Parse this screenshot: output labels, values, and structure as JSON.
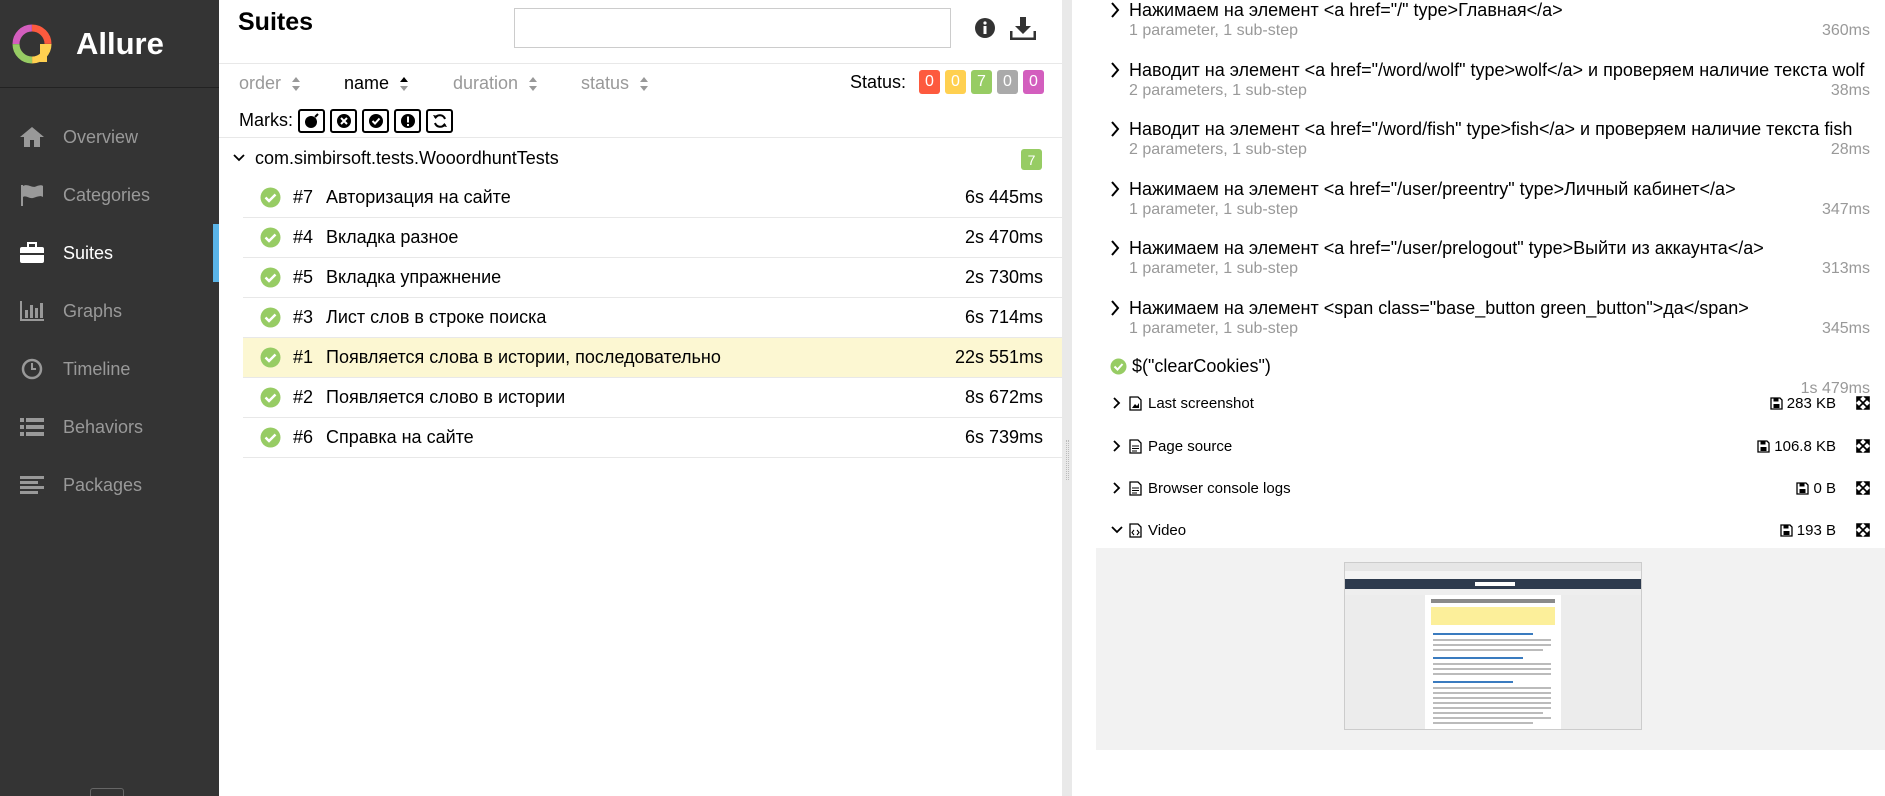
{
  "app": {
    "name": "Allure"
  },
  "nav": [
    {
      "label": "Overview",
      "icon": "home-icon"
    },
    {
      "label": "Categories",
      "icon": "flag-icon"
    },
    {
      "label": "Suites",
      "icon": "briefcase-icon",
      "active": true
    },
    {
      "label": "Graphs",
      "icon": "bar-chart-icon"
    },
    {
      "label": "Timeline",
      "icon": "clock-icon"
    },
    {
      "label": "Behaviors",
      "icon": "list-icon"
    },
    {
      "label": "Packages",
      "icon": "align-left-icon"
    }
  ],
  "suites": {
    "title": "Suites",
    "search_placeholder": "",
    "sort": {
      "order": "order",
      "name": "name",
      "duration": "duration",
      "status": "status"
    },
    "status_label": "Status:",
    "status_counts": [
      {
        "value": "0",
        "color": "#fd5a3e"
      },
      {
        "value": "0",
        "color": "#ffd050"
      },
      {
        "value": "7",
        "color": "#97cc64"
      },
      {
        "value": "0",
        "color": "#aaaaaa"
      },
      {
        "value": "0",
        "color": "#d35ebe"
      }
    ],
    "marks_label": "Marks:",
    "group": {
      "name": "com.simbirsoft.tests.WooordhuntTests",
      "count": "7"
    },
    "tests": [
      {
        "num": "#7",
        "name": "Авторизация на сайте",
        "duration": "6s 445ms"
      },
      {
        "num": "#4",
        "name": "Вкладка разное",
        "duration": "2s 470ms"
      },
      {
        "num": "#5",
        "name": "Вкладка упражнение",
        "duration": "2s 730ms"
      },
      {
        "num": "#3",
        "name": "Лист слов в строке поиска",
        "duration": "6s 714ms"
      },
      {
        "num": "#1",
        "name": "Появляется слова в истории, последовательно",
        "duration": "22s 551ms",
        "highlight": true
      },
      {
        "num": "#2",
        "name": "Появляется слово в истории",
        "duration": "8s 672ms"
      },
      {
        "num": "#6",
        "name": "Справка на сайте",
        "duration": "6s 739ms"
      }
    ]
  },
  "details": {
    "steps": [
      {
        "title": "Нажимаем на элемент <a href=\"/\" type>Главная</a>",
        "sub": "1 parameter, 1 sub-step",
        "duration": "360ms"
      },
      {
        "title": "Наводит на элемент <a href=\"/word/wolf\" type>wolf</a> и проверяем наличие текста wolf",
        "sub": "2 parameters, 1 sub-step",
        "duration": "38ms"
      },
      {
        "title": "Наводит на элемент <a href=\"/word/fish\" type>fish</a> и проверяем наличие текста fish",
        "sub": "2 parameters, 1 sub-step",
        "duration": "28ms"
      },
      {
        "title": "Нажимаем на элемент <a href=\"/user/preentry\" type>Личный кабинет</a>",
        "sub": "1 parameter, 1 sub-step",
        "duration": "347ms"
      },
      {
        "title": "Нажимаем на элемент <a href=\"/user/prelogout\" type>Выйти из аккаунта</a>",
        "sub": "1 parameter, 1 sub-step",
        "duration": "313ms"
      },
      {
        "title": "Нажимаем на элемент <span class=\"base_button green_button\">да</span>",
        "sub": "1 parameter, 1 sub-step",
        "duration": "345ms"
      }
    ],
    "clear": {
      "title": "$(\"clearCookies\")",
      "duration": "1s 479ms"
    },
    "attachments": [
      {
        "name": "Last screenshot",
        "size": "283 KB",
        "icon": "image-file-icon",
        "expanded": false
      },
      {
        "name": "Page source",
        "size": "106.8 KB",
        "icon": "text-file-icon",
        "expanded": false
      },
      {
        "name": "Browser console logs",
        "size": "0 B",
        "icon": "text-file-icon",
        "expanded": false
      },
      {
        "name": "Video",
        "size": "193 B",
        "icon": "code-file-icon",
        "expanded": true
      }
    ]
  }
}
